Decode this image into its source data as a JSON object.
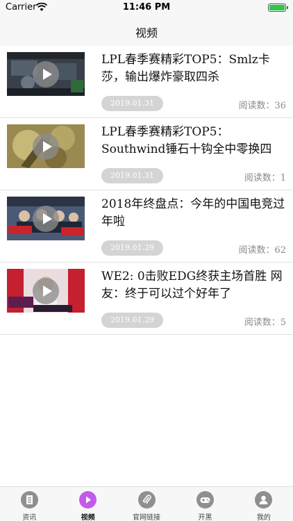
{
  "status_bar": {
    "carrier": "Carrier",
    "time": "11:46 PM"
  },
  "nav": {
    "title": "视频"
  },
  "videos": [
    {
      "title": "LPL春季赛精彩TOP5：Smlz卡莎，输出爆炸豪取四杀",
      "date": "2019.01.31",
      "reads": "阅读数：36"
    },
    {
      "title": "LPL春季赛精彩TOP5：Southwind锤石十钩全中零换四",
      "date": "2019.01.31",
      "reads": "阅读数：1"
    },
    {
      "title": "2018年终盘点：今年的中国电竞过年啦",
      "date": "2019.01.29",
      "reads": "阅读数：62"
    },
    {
      "title": "WE2: 0击败EDG终获主场首胜 网友：终于可以过个好年了",
      "date": "2019.01.29",
      "reads": "阅读数：5"
    }
  ],
  "tabs": [
    {
      "label": "资讯",
      "icon": "document-icon"
    },
    {
      "label": "视频",
      "icon": "play-icon"
    },
    {
      "label": "官网链接",
      "icon": "paperclip-icon"
    },
    {
      "label": "开黑",
      "icon": "gamepad-icon"
    },
    {
      "label": "我的",
      "icon": "user-icon"
    }
  ],
  "colors": {
    "accent": "#c45ae8",
    "inactive": "#8f8f8f",
    "battery": "#2cc84a"
  }
}
